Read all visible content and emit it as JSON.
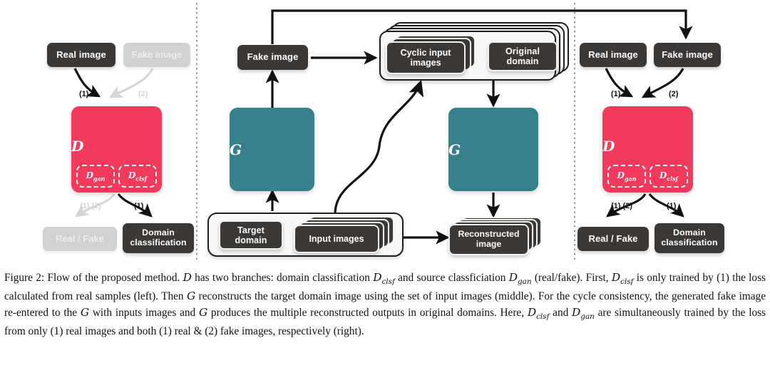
{
  "figure": {
    "caption_label": "Figure 2:",
    "caption_text": "Flow of the proposed method. D has two branches: domain classification Dclsf and source classficiation Dgan (real/fake). First, Dclsf is only trained by (1) the loss calculated from real samples (left). Then G reconstructs the target domain image using the set of input images (middle). For the cycle consistency, the generated fake image re-entered to the G with inputs images and G produces the multiple reconstructed outputs in original domains. Here, Dclsf and Dgan are simultaneously trained by the loss from only (1) real images and both (1) real & (2) fake images, respectively (right)."
  },
  "colors": {
    "discriminator": "#f23a5c",
    "generator": "#35808a",
    "node_dark": "#3b3836",
    "node_faded": "#d2d2d2",
    "arrow": "#111111",
    "arrow_faded": "#d6d6d6"
  },
  "panels": {
    "left": {
      "name": "left-panel",
      "nodes": {
        "real_image": "Real image",
        "fake_image": "Fake image",
        "discriminator": "D",
        "d_gan": "D",
        "d_gan_sub": "gan",
        "d_clsf": "D",
        "d_clsf_sub": "clsf",
        "real_fake": "Real / Fake",
        "domain_classification": "Domain\nclassification"
      },
      "arrow_labels": {
        "real_to_d": "(1)",
        "fake_to_d": "(2)",
        "d_to_realfake": "(1).(2)",
        "d_to_domain": "(1)"
      }
    },
    "middle": {
      "name": "middle-panel",
      "nodes": {
        "fake_image": "Fake image",
        "cyclic_input_images": "Cyclic input\nimages",
        "original_domain": "Original\ndomain",
        "generator_left": "G",
        "generator_right": "G",
        "target_domain": "Target\ndomain",
        "input_images": "Input images",
        "reconstructed_image": "Reconstructed\nimage"
      }
    },
    "right": {
      "name": "right-panel",
      "nodes": {
        "real_image": "Real image",
        "fake_image": "Fake image",
        "discriminator": "D",
        "d_gan": "D",
        "d_gan_sub": "gan",
        "d_clsf": "D",
        "d_clsf_sub": "clsf",
        "real_fake": "Real / Fake",
        "domain_classification": "Domain\nclassification"
      },
      "arrow_labels": {
        "real_to_d": "(1)",
        "fake_to_d": "(2)",
        "d_to_realfake": "(1).(2)",
        "d_to_domain": "(1)"
      }
    }
  }
}
